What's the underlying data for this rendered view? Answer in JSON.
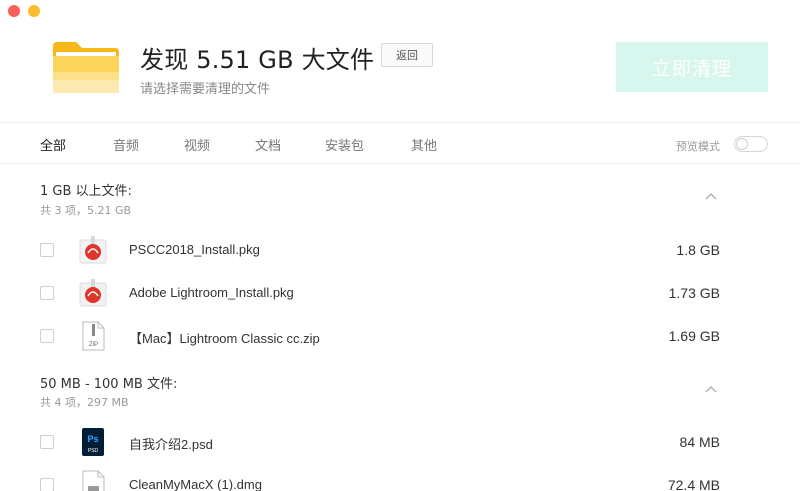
{
  "header": {
    "title": "发现 5.51 GB 大文件",
    "subtitle": "请选择需要清理的文件",
    "back_label": "返回",
    "clean_label": "立即清理"
  },
  "tabs": [
    {
      "label": "全部",
      "active": true
    },
    {
      "label": "音频",
      "active": false
    },
    {
      "label": "视频",
      "active": false
    },
    {
      "label": "文档",
      "active": false
    },
    {
      "label": "安装包",
      "active": false
    },
    {
      "label": "其他",
      "active": false
    }
  ],
  "preview_mode": {
    "label": "预览模式",
    "enabled": false
  },
  "groups": [
    {
      "title": "1 GB 以上文件:",
      "summary": "共 3 项，5.21 GB",
      "files": [
        {
          "name": "PSCC2018_Install.pkg",
          "size": "1.8 GB",
          "icon": "adobe-package-icon",
          "checked": false
        },
        {
          "name": "Adobe Lightroom_Install.pkg",
          "size": "1.73 GB",
          "icon": "adobe-package-icon",
          "checked": false
        },
        {
          "name": "【Mac】Lightroom Classic cc.zip",
          "size": "1.69 GB",
          "icon": "zip-file-icon",
          "checked": false
        }
      ]
    },
    {
      "title": "50 MB - 100 MB 文件:",
      "summary": "共 4 项，297 MB",
      "files": [
        {
          "name": "自我介绍2.psd",
          "size": "84 MB",
          "icon": "psd-file-icon",
          "checked": false
        },
        {
          "name": "CleanMyMacX (1).dmg",
          "size": "72.4 MB",
          "icon": "dmg-file-icon",
          "checked": false
        }
      ]
    }
  ],
  "colors": {
    "accent_disabled": "#d6f6ee",
    "folder": "#fdc83a",
    "adobe_red": "#e0352b",
    "ps_blue": "#31a8ff"
  }
}
